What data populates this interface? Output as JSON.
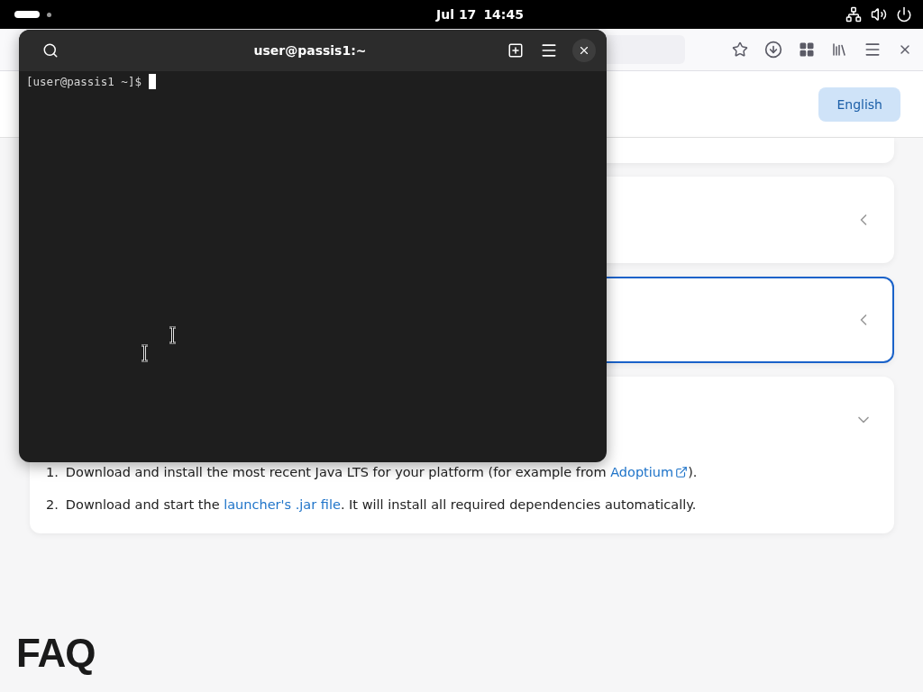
{
  "top_bar": {
    "date": "Jul 17",
    "time": "14:45"
  },
  "terminal": {
    "title": "user@passis1:~",
    "prompt": "[user@passis1 ~]$"
  },
  "browser": {
    "language_button": "English",
    "accordion": [
      {
        "expanded": false,
        "focused": false
      },
      {
        "expanded": false,
        "focused": true
      },
      {
        "expanded": true,
        "focused": false,
        "steps": [
          {
            "number": "1.",
            "parts": [
              {
                "text": "Download and install the most recent Java LTS for your platform (for example from "
              },
              {
                "link": "Adoptium",
                "external": true
              },
              {
                "text": ")."
              }
            ]
          },
          {
            "number": "2.",
            "parts": [
              {
                "text": "Download and start the "
              },
              {
                "link": "launcher's .jar file",
                "external": false
              },
              {
                "text": ". It will install all required dependencies automatically."
              }
            ]
          }
        ]
      }
    ],
    "faq_title": "FAQ"
  }
}
